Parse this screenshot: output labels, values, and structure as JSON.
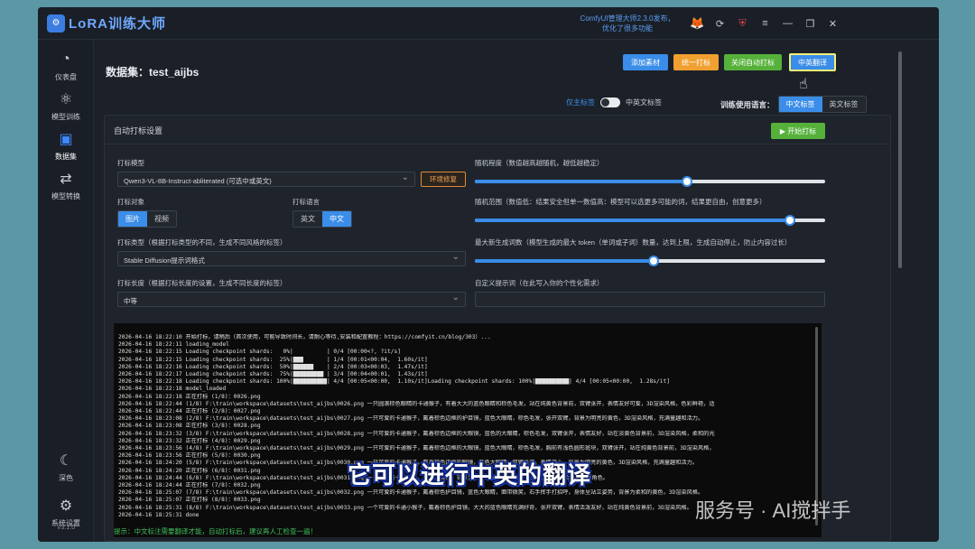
{
  "app": {
    "logo_badge": "LoRA",
    "logo_text": "LoRA训练大师",
    "update_note": "ComfyUI管理大师2.3.0发布，优化了很多功能",
    "version": "V3.1.0"
  },
  "window_icons": [
    "fox-icon",
    "refresh-icon",
    "shield-icon",
    "menu-icon",
    "minimize-icon",
    "restore-icon",
    "close-icon"
  ],
  "sidebar": {
    "items": [
      {
        "label": "仪表盘",
        "icon": "dashboard-icon",
        "active": false
      },
      {
        "label": "模型训练",
        "icon": "train-icon",
        "active": false
      },
      {
        "label": "数据集",
        "icon": "dataset-icon",
        "active": true
      },
      {
        "label": "模型转换",
        "icon": "convert-icon",
        "active": false
      }
    ],
    "bottom": [
      {
        "label": "深色",
        "icon": "moon-icon"
      },
      {
        "label": "系统设置",
        "icon": "settings-icon"
      }
    ]
  },
  "header": {
    "dataset_title": "数据集：test_aijbs",
    "buttons": {
      "add_material": "添加素材",
      "batch_tag": "统一打标",
      "close_auto_tag": "关闭自动打标",
      "cn_translate": "中英翻译"
    }
  },
  "tag_controls": {
    "only_tags_label": "仅主标签",
    "bilingual_label": "中英文标签",
    "train_lang_label": "训练使用语言：",
    "lang_options": [
      "中文标签",
      "英文标签"
    ],
    "lang_selected": "中文标签"
  },
  "panel": {
    "title": "自动打标设置",
    "start_button": "▶ 开始打标",
    "model_label": "打标模型",
    "model_value": "Qwen3-VL-8B-Instruct-abliterated (可选中或英文)",
    "env_button": "环境修复",
    "target_label": "打标对象",
    "target_options": [
      "图片",
      "视频"
    ],
    "target_selected": "图片",
    "lang_label": "打标语言",
    "lang_options": [
      "英文",
      "中文"
    ],
    "lang_selected": "中文",
    "type_label": "打标类型（根据打标类型的不同，生成不同风格的标签）",
    "type_value": "Stable Diffusion提示词格式",
    "length_label": "打标长度（根据打标长度的设置，生成不同长度的标签）",
    "length_value": "中等",
    "random_label": "随机程度（数值越高越随机，越低越稳定）",
    "random_value": 0.605,
    "range_label": "随机范围（数值低：结果安全但单一数值高：模型可以选更多可能的词，结果更自由，创意更多）",
    "range_value": 0.9,
    "max_tokens_label": "最大新生成词数（模型生成的最大 token（单词或子词）数量，达到上限，生成自动停止，防止内容过长）",
    "max_tokens_value": 0.51,
    "custom_prompt_label": "自定义提示词（在此写入你的个性化需求）",
    "custom_prompt_value": ""
  },
  "console_lines": [
    "2026-04-16 18:22:10 开始打标，请稍后（首次使用，可能导致时间长，请耐心等待,安装和配置教程：https://comfyit.cn/blog/303）...",
    "2026-04-16 18:22:11 loading_model",
    "2026-04-16 18:22:15 Loading checkpoint shards:   0%|          | 0/4 [00:00<?, ?it/s]",
    "2026-04-16 18:22:15 Loading checkpoint shards:  25%|███       | 1/4 [00:01<00:04,  1.60s/it]",
    "2026-04-16 18:22:16 Loading checkpoint shards:  50%|██████    | 2/4 [00:03<00:03,  1.47s/it]",
    "2026-04-16 18:22:17 Loading checkpoint shards:  75%|█████████ | 3/4 [00:04<00:01,  1.43s/it]",
    "2026-04-16 18:22:18 Loading checkpoint shards: 100%|██████████| 4/4 [00:05<00:00,  1.10s/it]Loading checkpoint shards: 100%|██████████| 4/4 [00:05<00:00,  1.28s/it]",
    "2026-04-16 18:22:18 model_loaded",
    "2026-04-16 18:22:18 正在打标 (1/8)：0026.png",
    "2026-04-16 18:22:44 (1/8) F:\\train\\workspace\\datasets\\test_aijbs\\0026.png 一只圆滚棕色眼睛的卡通猴子，有着大大的蓝色眼睛和棕色毛发，站在纯黄色背景前，双臂张开，表情友好可爱，3D渲染风格，色彩鲜艳，适",
    "2026-04-16 18:22:44 正在打标 (2/8)：0027.png",
    "2026-04-16 18:23:08 (2/8) F:\\train\\workspace\\datasets\\test_aijbs\\0027.png 一只可爱的卡通猴子，戴着棕色边框的护目镜，蓝色大眼睛，棕色毛发，张开双臂，背景为明亮的黄色，3D渲染风格，充满童趣和活力。",
    "2026-04-16 18:23:08 正在打标 (3/8)：0028.png",
    "2026-04-16 18:23:32 (3/8) F:\\train\\workspace\\datasets\\test_aijbs\\0028.png 一只可爱的卡通猴子，戴着棕色边框的大眼镜，蓝色的大眼睛，棕色毛发，双臂张开，表情友好，站在淡黄色背景前，3D渲染风格，柔和的光",
    "2026-04-16 18:23:32 正在打标 (4/8)：0029.png",
    "2026-04-16 18:23:56 (4/8) F:\\train\\workspace\\datasets\\test_aijbs\\0029.png 一只可爱的卡通猴子，戴着棕色边框的大眼镜，蓝色大眼睛，棕色毛发，胸前有浅色圆形斑块，双臂张开，站在纯黄色背景前，3D渲染风格，",
    "2026-04-16 18:23:56 正在打标 (5/8)：0030.png",
    "2026-04-16 18:24:20 (5/8) F:\\train\\workspace\\datasets\\test_aijbs\\0030.png 一只可爱的卡通猴子，戴着棕色边框的眼镜，蓝色大眼睛，双臂张开，表情开心，背景为明亮的黄色，3D渲染风格，充满童趣和活力。",
    "2026-04-16 18:24:20 正在打标 (6/8)：0031.png",
    "2026-04-16 18:24:44 (6/8) F:\\train\\workspace\\datasets\\test_aijbs\\0031.png 一只可爱的卡通猴子，戴着护目镜，背景为柔和的暖黄色光晕，3D渲染风格，适合儿童动画角色。",
    "2026-04-16 18:24:44 正在打标 (7/8)：0032.png",
    "2026-04-16 18:25:07 (7/8) F:\\train\\workspace\\datasets\\test_aijbs\\0032.png 一只可爱的卡通猴子，戴着棕色护目镜，蓝色大眼睛，面带微笑，右手挥手打招呼，身体呈站立姿势，背景为柔和的黄色，3D渲染风格。",
    "2026-04-16 18:25:07 正在打标 (8/8)：0033.png",
    "2026-04-16 18:25:31 (8/8) F:\\train\\workspace\\datasets\\test_aijbs\\0033.png 一个可爱的卡通小猴子，戴着棕色护目镜，大大的蓝色眼睛充满好奇，张开双臂，表情活泼友好，站在纯黄色背景前，3D渲染风格。",
    "2026-04-16 18:25:31 done"
  ],
  "hint": "提示：中文标注需要翻译才能，自动打标后，建议再人工检查一遍！",
  "overlay": {
    "subtitle": "它可以进行中英的翻译",
    "watermark": "服务号 · AI搅拌手"
  },
  "colors": {
    "accent": "#3a8de8",
    "orange": "#f0a030",
    "green": "#55b13a",
    "background": "#5b97a4",
    "panel": "#1f242c"
  }
}
